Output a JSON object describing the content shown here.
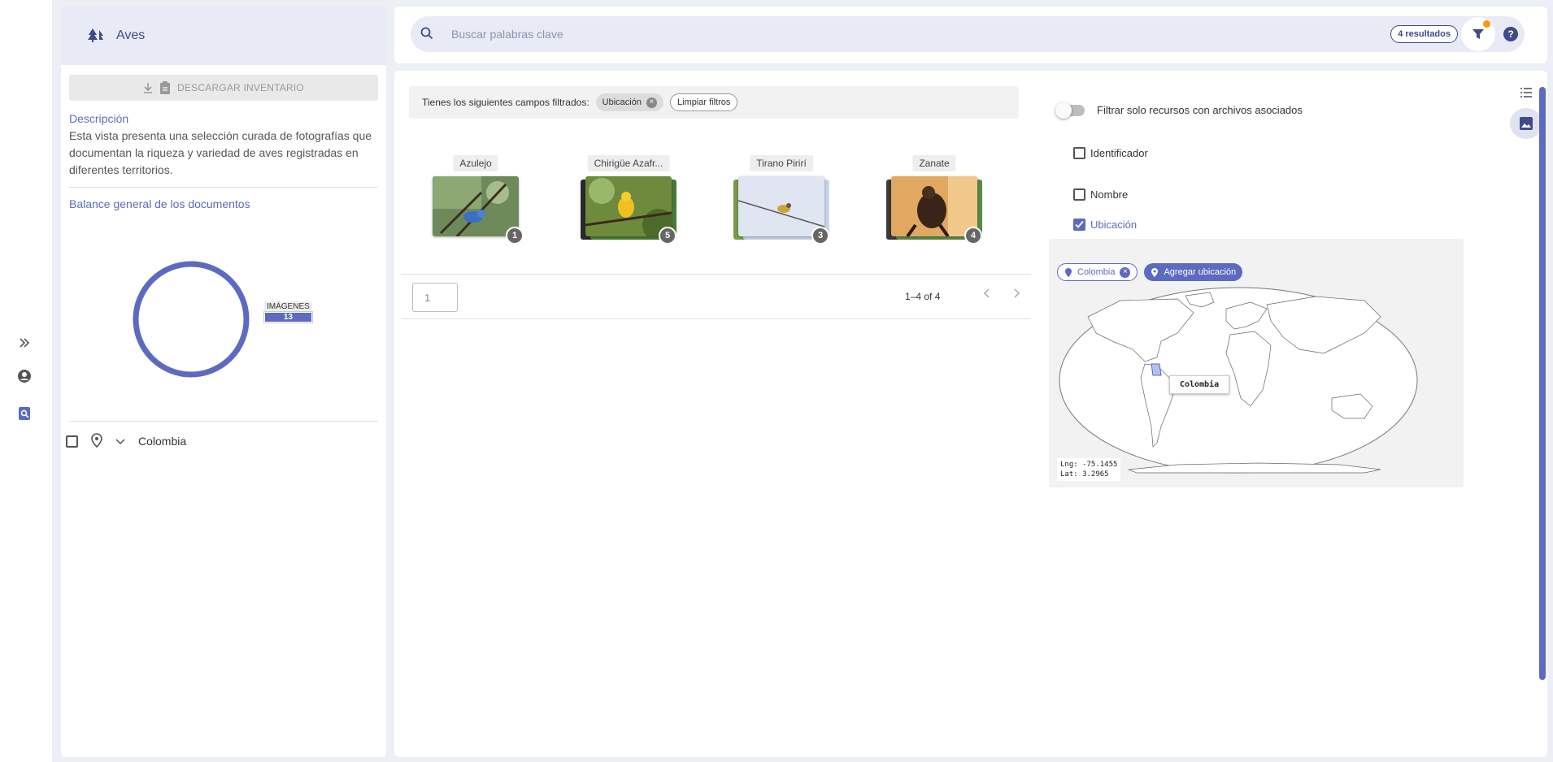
{
  "sidebar": {
    "title": "Aves",
    "download_label": "DESCARGAR INVENTARIO",
    "description_title": "Descripción",
    "description": "Esta vista presenta una selección curada de fotografías que documentan la riqueza y variedad de aves registradas en diferentes territorios.",
    "balance_title": "Balance general de los documentos",
    "donut": {
      "label": "IMÁGENES",
      "value": "13",
      "color": "#5c6bc0"
    },
    "tree_item": "Colombia"
  },
  "search": {
    "placeholder": "Buscar palabras clave",
    "results_badge": "4 resultados"
  },
  "filters": {
    "prefix": "Tienes los siguientes campos filtrados:",
    "active_chip": "Ubicación",
    "clear_label": "Limpiar filtros"
  },
  "cards": [
    {
      "label": "Azulejo",
      "count": "1"
    },
    {
      "label": "Chirigüe Azafr...",
      "count": "5"
    },
    {
      "label": "Tirano Pirirí",
      "count": "3"
    },
    {
      "label": "Zanate",
      "count": "4"
    }
  ],
  "pager": {
    "page_value": "1",
    "range": "1–4 of 4"
  },
  "right_panel": {
    "toggle_label": "Filtrar solo recursos con archivos asociados",
    "options": [
      {
        "label": "Identificador",
        "checked": false
      },
      {
        "label": "Nombre",
        "checked": false
      },
      {
        "label": "Ubicación",
        "checked": true
      }
    ],
    "map": {
      "location_chip": "Colombia",
      "add_label": "Agregar ubicación",
      "tooltip": "Colombia",
      "lng": "Lng: -75.1455",
      "lat": "Lat: 3.2965"
    }
  },
  "colors": {
    "accent": "#5c6bc0",
    "notify": "#ff9800"
  }
}
